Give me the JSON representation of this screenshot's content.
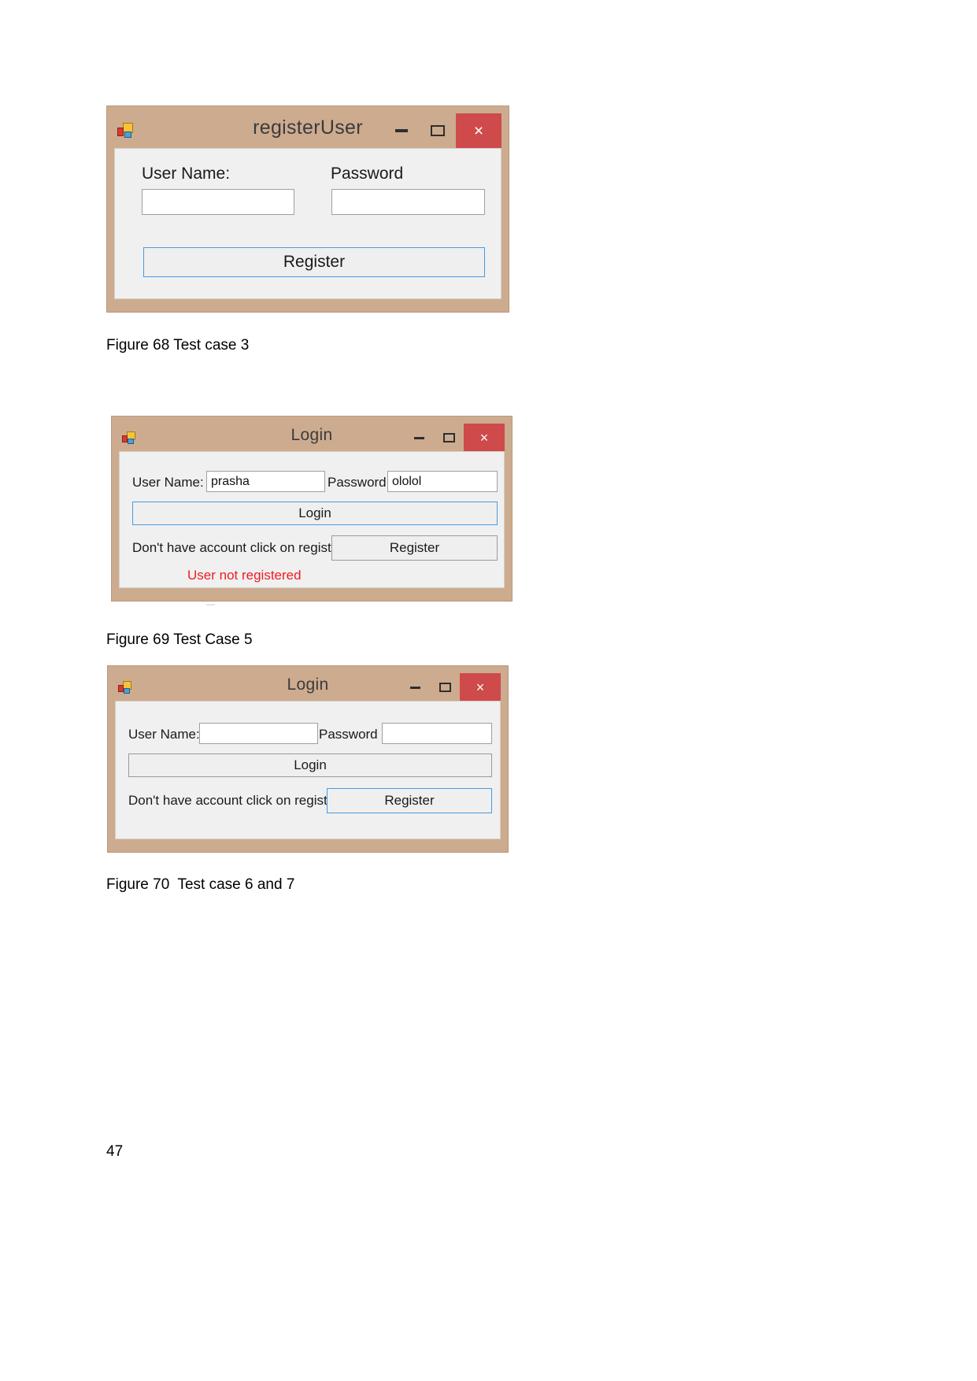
{
  "document": {
    "page_number": "47",
    "captions": [
      "Figure 68 Test case 3",
      "Figure 69 Test Case 5",
      "Figure 70  Test case 6 and 7"
    ]
  },
  "colors": {
    "window_frame": "#cdab8f",
    "client_background": "#f0f0f0",
    "close_button": "#cf4a4a",
    "focus_border": "#4a9ae0",
    "error_text": "#ed1c24"
  },
  "windows": [
    {
      "id": "register-user",
      "title": "registerUser",
      "icon": "winforms-app-icon",
      "caption_buttons": {
        "minimize": "–",
        "maximize": "❑",
        "close": "×"
      },
      "fields": {
        "username_label": "User Name:",
        "username_value": "",
        "username_placeholder": "",
        "password_label": "Password",
        "password_value": "",
        "password_placeholder": ""
      },
      "buttons": {
        "register": "Register"
      }
    },
    {
      "id": "login-filled",
      "title": "Login",
      "icon": "winforms-app-icon",
      "caption_buttons": {
        "minimize": "–",
        "maximize": "❑",
        "close": "×"
      },
      "fields": {
        "username_label": "User Name:",
        "username_value": "prasha",
        "username_placeholder": "",
        "password_label": "Password",
        "password_value": "ololol",
        "password_placeholder": ""
      },
      "buttons": {
        "login": "Login",
        "register": "Register"
      },
      "hint_text": "Don't have account click on register",
      "status_message": "User not registered"
    },
    {
      "id": "login-empty",
      "title": "Login",
      "icon": "winforms-app-icon",
      "caption_buttons": {
        "minimize": "–",
        "maximize": "❑",
        "close": "×"
      },
      "fields": {
        "username_label": "User Name:",
        "username_value": "",
        "username_placeholder": "",
        "password_label": "Password",
        "password_value": "",
        "password_placeholder": ""
      },
      "buttons": {
        "login": "Login",
        "register": "Register"
      },
      "hint_text": "Don't have account click on register",
      "status_message": ""
    }
  ]
}
